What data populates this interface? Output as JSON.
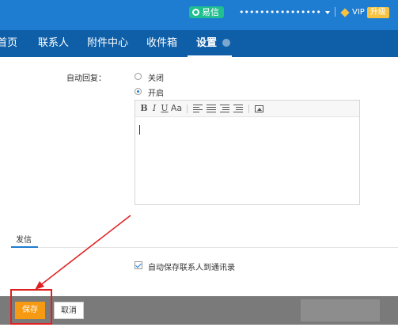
{
  "topbar": {
    "yixin_label": "易信",
    "account_label": "••••••••••••••••",
    "vip_label": "VIP",
    "upgrade_label": "升级"
  },
  "nav": {
    "items": [
      {
        "label": "首页"
      },
      {
        "label": "联系人"
      },
      {
        "label": "附件中心"
      },
      {
        "label": "收件箱"
      },
      {
        "label": "设置"
      }
    ]
  },
  "settings": {
    "auto_reply_label": "自动回复：",
    "radio_off_label": "关闭",
    "radio_on_label": "开启",
    "selected": "开启",
    "editor_value": ""
  },
  "compose": {
    "tab_label": "发信",
    "save_contacts_label": "自动保存联系人到通讯录",
    "save_contacts_checked": true
  },
  "bottom": {
    "save_label": "保存",
    "cancel_label": "取消"
  },
  "colors": {
    "topbar": "#1e7cd1",
    "nav": "#0f5fa8",
    "accent": "#f59a12",
    "highlight": "#e02020"
  }
}
